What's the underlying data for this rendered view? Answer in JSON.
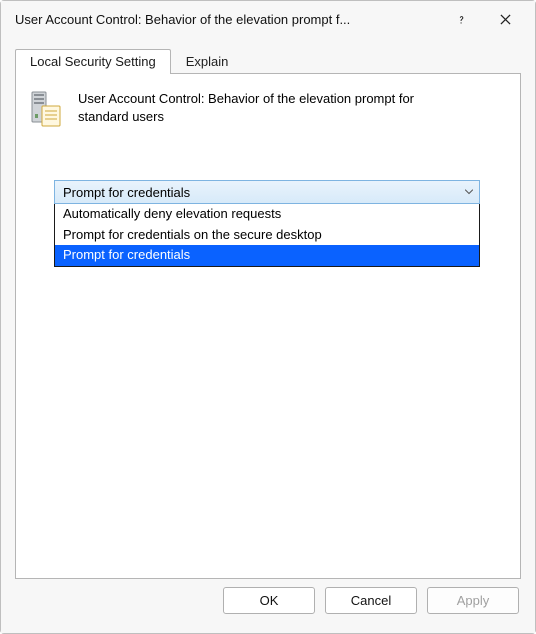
{
  "window": {
    "title": "User Account Control: Behavior of the elevation prompt f..."
  },
  "tabs": {
    "local_security_setting": "Local Security Setting",
    "explain": "Explain",
    "active": "local_security_setting"
  },
  "policy": {
    "full_title": "User Account Control: Behavior of the elevation prompt for standard users"
  },
  "dropdown": {
    "selected_display": "Prompt for credentials",
    "options": {
      "0": "Automatically deny elevation requests",
      "1": "Prompt for credentials on the secure desktop",
      "2": "Prompt for credentials"
    },
    "highlighted_index": 2
  },
  "buttons": {
    "ok": "OK",
    "cancel": "Cancel",
    "apply": "Apply"
  }
}
